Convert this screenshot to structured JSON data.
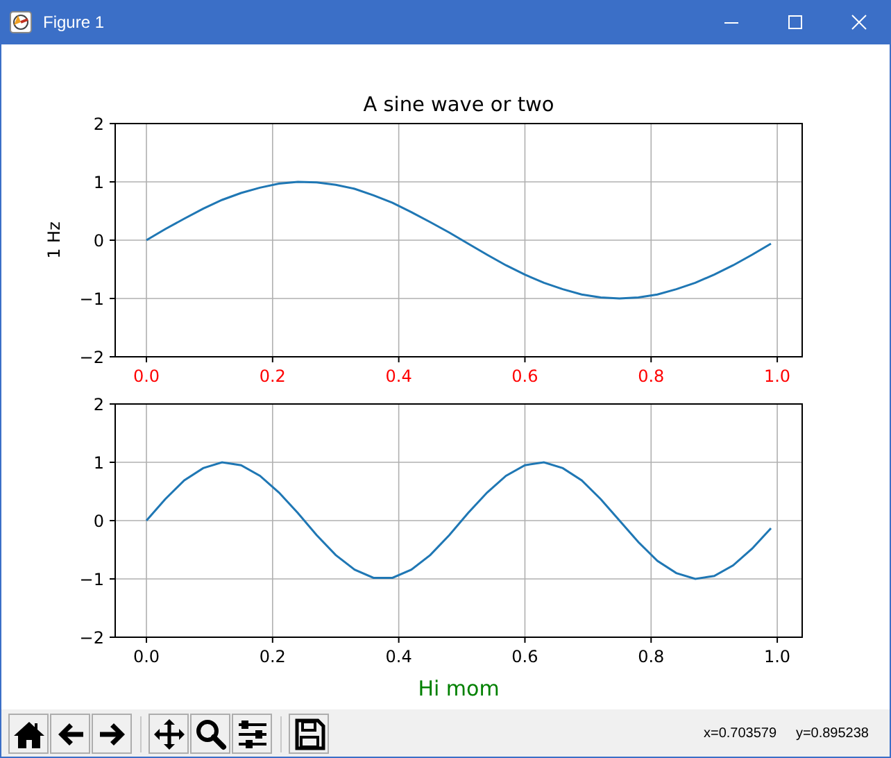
{
  "window": {
    "title": "Figure 1"
  },
  "figure": {
    "panels": [
      {
        "xtick_labels": {
          "color": "#ff0000"
        },
        "chart_data": {
          "type": "line",
          "title": "A sine wave or two",
          "ylabel": "1 Hz",
          "grid": true,
          "x": [
            0,
            0.03,
            0.06,
            0.09,
            0.12,
            0.15,
            0.18,
            0.21,
            0.24,
            0.27,
            0.3,
            0.33,
            0.36,
            0.39,
            0.42,
            0.45,
            0.48,
            0.51,
            0.54,
            0.57,
            0.6,
            0.63,
            0.66,
            0.69,
            0.72,
            0.75,
            0.78,
            0.81,
            0.84,
            0.87,
            0.9,
            0.93,
            0.96,
            0.99
          ],
          "series": [
            {
              "color": "#1f77b4",
              "values": [
                0,
                0.19,
                0.37,
                0.54,
                0.69,
                0.81,
                0.9,
                0.97,
                1,
                0.99,
                0.95,
                0.88,
                0.77,
                0.64,
                0.48,
                0.31,
                0.13,
                -0.06,
                -0.25,
                -0.43,
                -0.59,
                -0.73,
                -0.84,
                -0.93,
                -0.98,
                -1,
                -0.98,
                -0.93,
                -0.84,
                -0.73,
                -0.59,
                -0.43,
                -0.25,
                -0.06
              ]
            }
          ],
          "xlim": [
            -0.0495,
            1.0395
          ],
          "ylim": [
            -2,
            2
          ],
          "xticks": [
            {
              "value": 0,
              "label": "0.0"
            },
            {
              "value": 0.2,
              "label": "0.2"
            },
            {
              "value": 0.4,
              "label": "0.4"
            },
            {
              "value": 0.6,
              "label": "0.6"
            },
            {
              "value": 0.8,
              "label": "0.8"
            },
            {
              "value": 1,
              "label": "1.0"
            }
          ],
          "yticks": [
            {
              "value": -2,
              "label": "−2"
            },
            {
              "value": -1,
              "label": "−1"
            },
            {
              "value": 0,
              "label": "0"
            },
            {
              "value": 1,
              "label": "1"
            },
            {
              "value": 2,
              "label": "2"
            }
          ]
        }
      },
      {
        "xlabel_text": {
          "color": "#008000"
        },
        "chart_data": {
          "type": "line",
          "xlabel": "Hi mom",
          "grid": true,
          "x": [
            0,
            0.03,
            0.06,
            0.09,
            0.12,
            0.15,
            0.18,
            0.21,
            0.24,
            0.27,
            0.3,
            0.33,
            0.36,
            0.39,
            0.42,
            0.45,
            0.48,
            0.51,
            0.54,
            0.57,
            0.6,
            0.63,
            0.66,
            0.69,
            0.72,
            0.75,
            0.78,
            0.81,
            0.84,
            0.87,
            0.9,
            0.93,
            0.96,
            0.99
          ],
          "series": [
            {
              "color": "#1f77b4",
              "values": [
                0,
                0.37,
                0.69,
                0.9,
                1,
                0.95,
                0.77,
                0.48,
                0.13,
                -0.25,
                -0.59,
                -0.84,
                -0.98,
                -0.98,
                -0.84,
                -0.59,
                -0.25,
                0.13,
                0.48,
                0.77,
                0.95,
                1,
                0.9,
                0.69,
                0.37,
                0,
                -0.37,
                -0.69,
                -0.9,
                -1,
                -0.95,
                -0.77,
                -0.48,
                -0.13
              ]
            }
          ],
          "xlim": [
            -0.0495,
            1.0395
          ],
          "ylim": [
            -2,
            2
          ],
          "xticks": [
            {
              "value": 0,
              "label": "0.0"
            },
            {
              "value": 0.2,
              "label": "0.2"
            },
            {
              "value": 0.4,
              "label": "0.4"
            },
            {
              "value": 0.6,
              "label": "0.6"
            },
            {
              "value": 0.8,
              "label": "0.8"
            },
            {
              "value": 1,
              "label": "1.0"
            }
          ],
          "yticks": [
            {
              "value": -2,
              "label": "−2"
            },
            {
              "value": -1,
              "label": "−1"
            },
            {
              "value": 0,
              "label": "0"
            },
            {
              "value": 1,
              "label": "1"
            },
            {
              "value": 2,
              "label": "2"
            }
          ]
        }
      }
    ]
  },
  "toolbar": {
    "groups": [
      [
        {
          "kind": "home"
        },
        {
          "kind": "back"
        },
        {
          "kind": "forward"
        }
      ],
      [
        {
          "kind": "pan"
        },
        {
          "kind": "zoom"
        },
        {
          "kind": "configure"
        }
      ],
      [
        {
          "kind": "save"
        }
      ]
    ],
    "status": "x=0.703579     y=0.895238"
  }
}
